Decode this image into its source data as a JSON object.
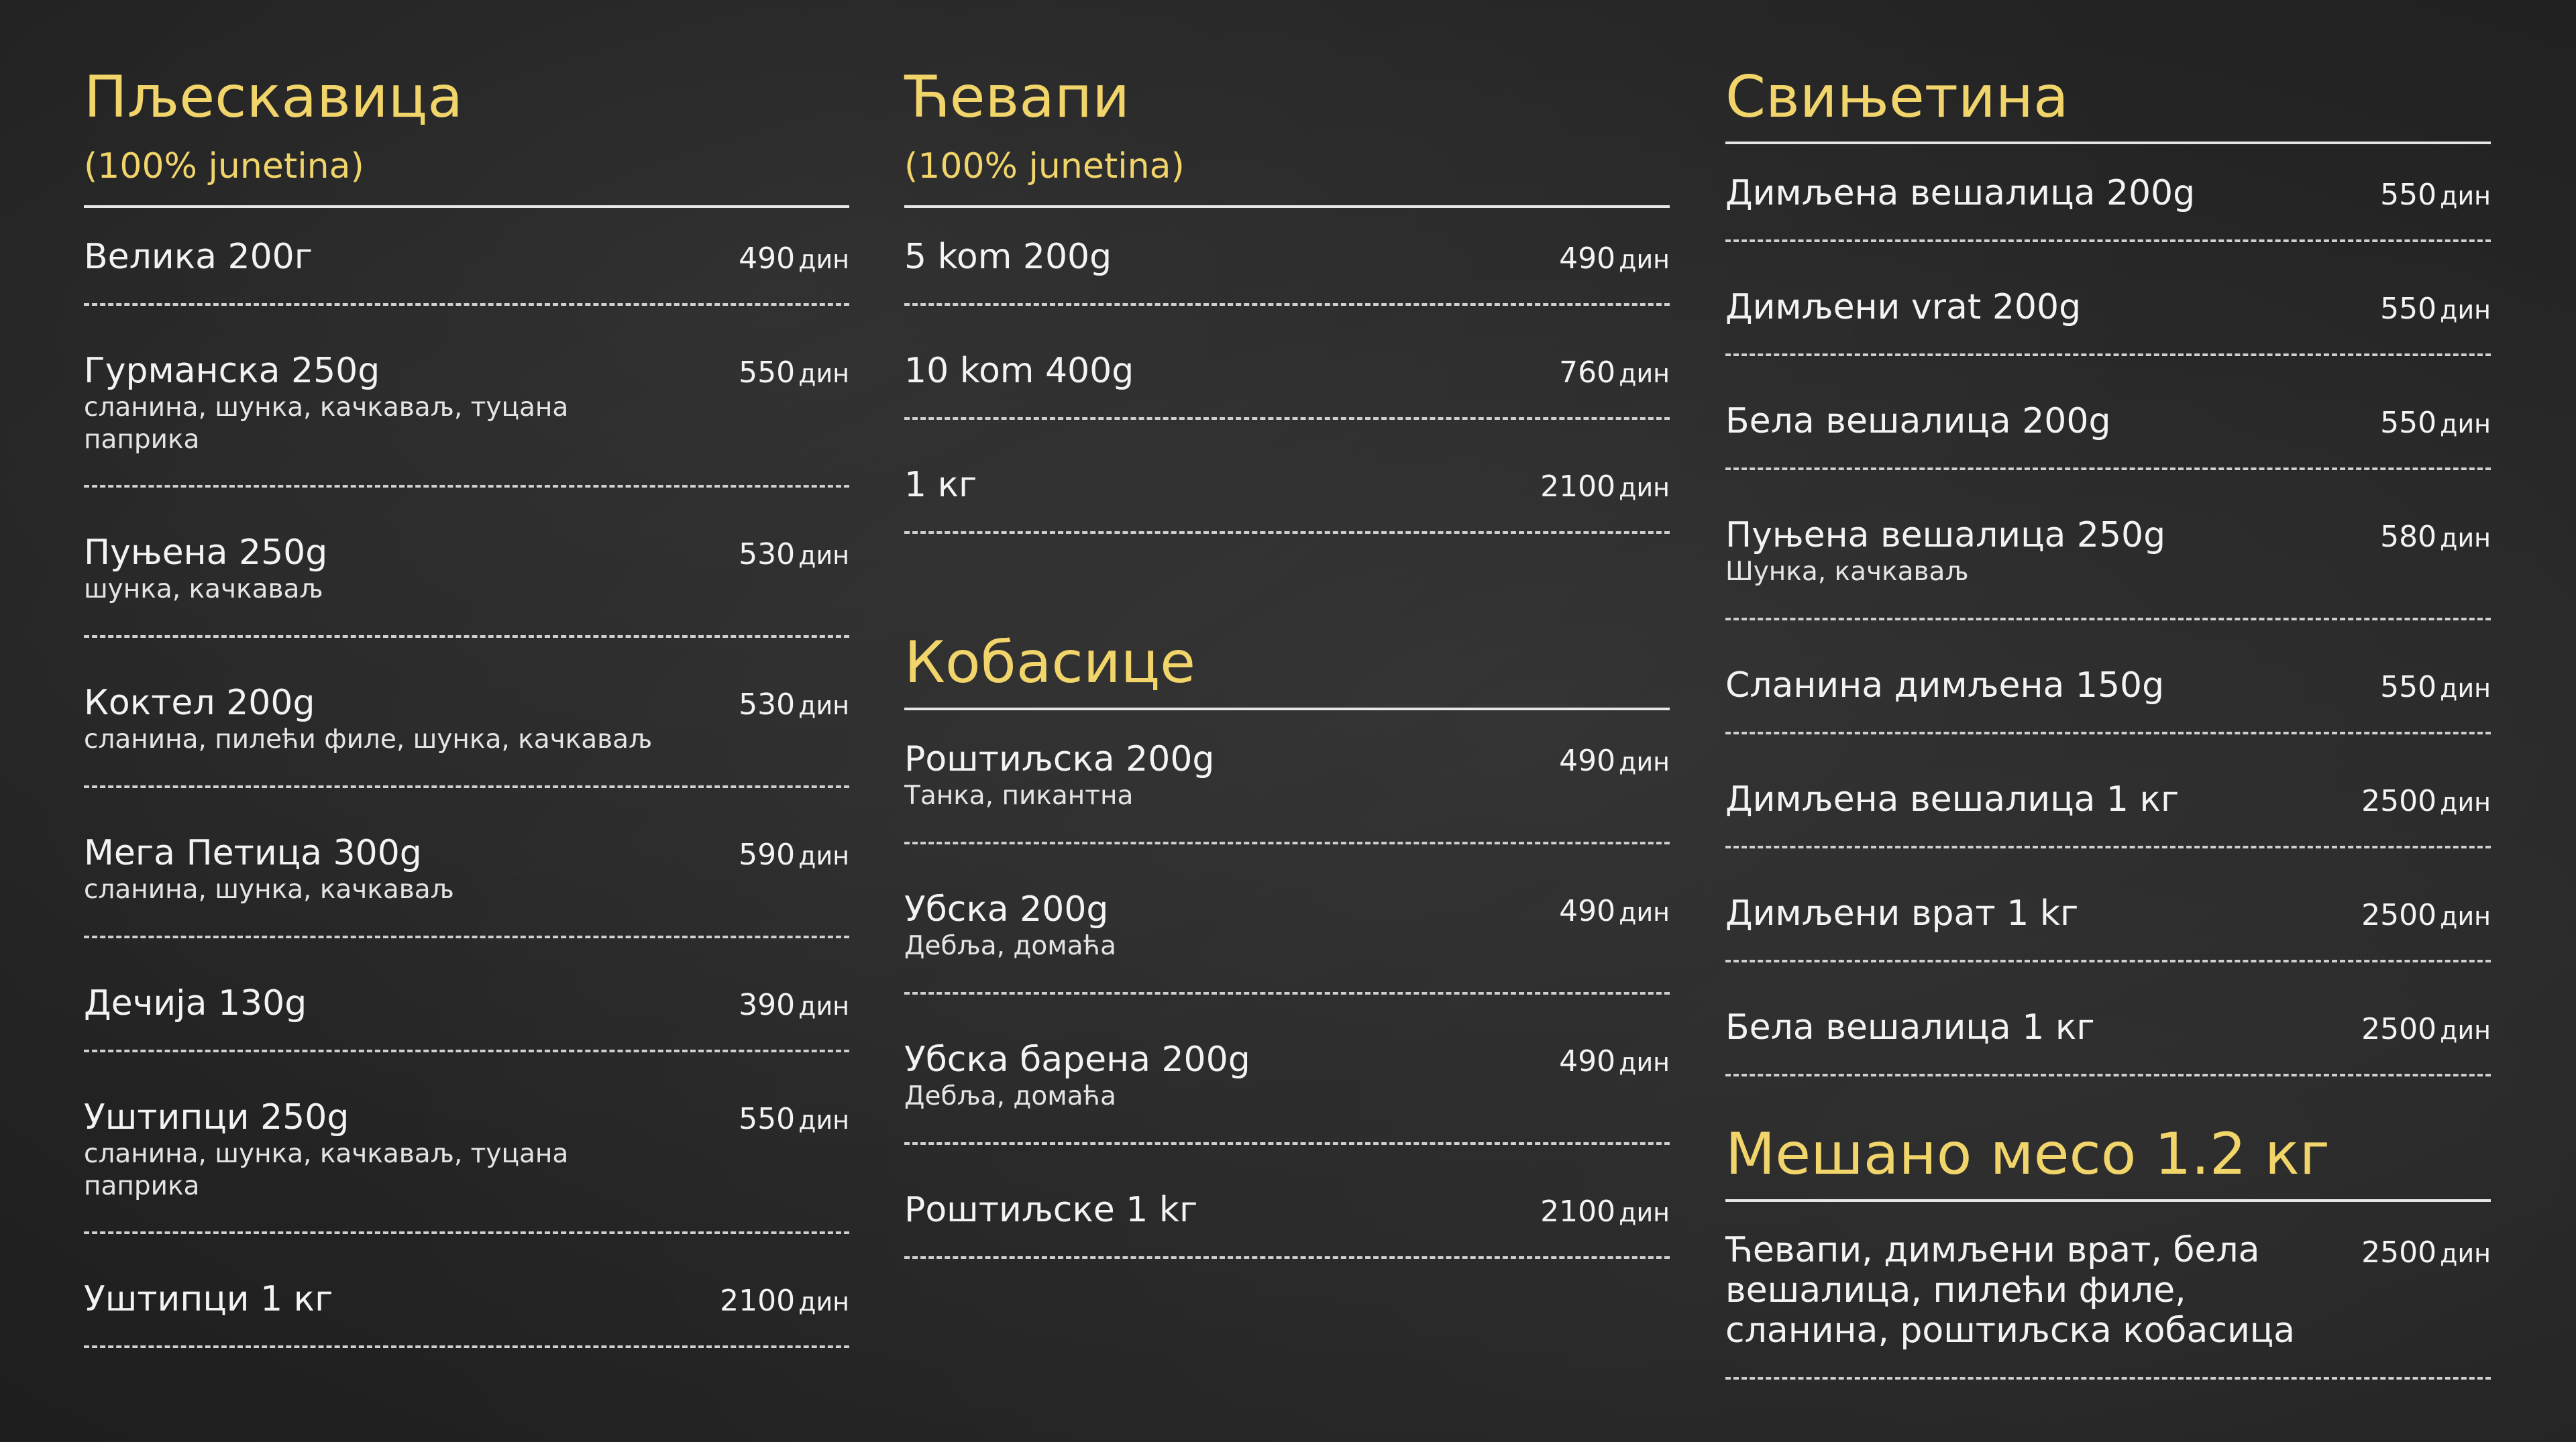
{
  "sections": {
    "pljeskavica": {
      "title": "Пљескавица",
      "subtitle": "(100% junetina)",
      "items": [
        {
          "name": "Велика 200г",
          "price": "490",
          "currency": "дин"
        },
        {
          "name": "Гурманска 250g",
          "price": "550",
          "currency": "дин",
          "desc": "сланина, шунка, качкаваљ, туцана паприка"
        },
        {
          "name": "Пуњена 250g",
          "price": "530",
          "currency": "дин",
          "desc": "шунка, качкаваљ"
        },
        {
          "name": "Коктел 200g",
          "price": "530",
          "currency": "дин",
          "desc": "сланина, пилећи филе, шунка, качкаваљ"
        },
        {
          "name": "Мега Петица 300g",
          "price": "590",
          "currency": "дин",
          "desc": "сланина, шунка, качкаваљ"
        },
        {
          "name": "Дечија 130g",
          "price": "390",
          "currency": "дин"
        },
        {
          "name": "Уштипци 250g",
          "price": "550",
          "currency": "дин",
          "desc": "сланина, шунка, качкаваљ, туцана паприка"
        },
        {
          "name": "Уштипци 1 кг",
          "price": "2100",
          "currency": "дин"
        }
      ]
    },
    "cevapi": {
      "title": "Ћевапи",
      "subtitle": "(100% junetina)",
      "items": [
        {
          "name": "5 kom 200g",
          "price": "490",
          "currency": "дин"
        },
        {
          "name": "10 kom 400g",
          "price": "760",
          "currency": "дин"
        },
        {
          "name": "1 кг",
          "price": "2100",
          "currency": "дин"
        }
      ]
    },
    "kobasice": {
      "title": "Кобасице",
      "items": [
        {
          "name": "Роштиљска 200g",
          "price": "490",
          "currency": "дин",
          "desc": "Танка, пикантна"
        },
        {
          "name": "Убска 200g",
          "price": "490",
          "currency": "дин",
          "desc": "Дебља, домаћа"
        },
        {
          "name": "Убска барена 200g",
          "price": "490",
          "currency": "дин",
          "desc": "Дебља, домаћа"
        },
        {
          "name": "Роштиљске 1 kг",
          "price": "2100",
          "currency": "дин"
        }
      ]
    },
    "svinjetina": {
      "title": "Свињетина",
      "items": [
        {
          "name": "Димљена вешалица 200g",
          "price": "550",
          "currency": "дин"
        },
        {
          "name": "Димљени vrat 200g",
          "price": "550",
          "currency": "дин"
        },
        {
          "name": "Бела вешалица 200g",
          "price": "550",
          "currency": "дин"
        },
        {
          "name": "Пуњена вешалица 250g",
          "price": "580",
          "currency": "дин",
          "desc": "Шунка, качкаваљ"
        },
        {
          "name": "Сланина димљена 150g",
          "price": "550",
          "currency": "дин"
        },
        {
          "name": "Димљена вешалица 1 кг",
          "price": "2500",
          "currency": "дин"
        },
        {
          "name": "Димљени врат 1 kг",
          "price": "2500",
          "currency": "дин"
        },
        {
          "name": "Бела вешалица 1 кг",
          "price": "2500",
          "currency": "дин"
        }
      ]
    },
    "meso": {
      "title": "Мешано месо 1.2 кг",
      "items": [
        {
          "name": "Ћевапи, димљени врат, бела вешалица, пилећи филе, сланина, роштиљска кобасица",
          "price": "2500",
          "currency": "дин"
        }
      ]
    }
  }
}
